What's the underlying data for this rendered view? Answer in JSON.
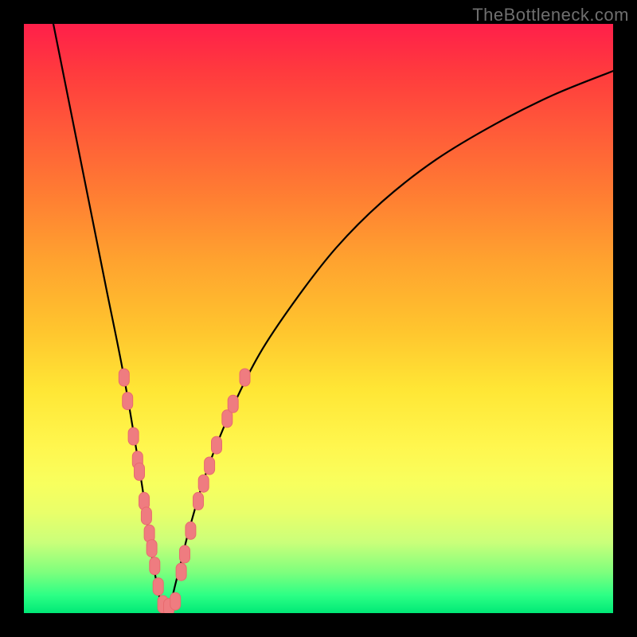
{
  "watermark": "TheBottleneck.com",
  "colors": {
    "frame": "#000000",
    "curve": "#000000",
    "marker_fill": "#ef7c80",
    "marker_stroke": "#e86a6e"
  },
  "chart_data": {
    "type": "line",
    "title": "",
    "xlabel": "",
    "ylabel": "",
    "xlim": [
      0,
      100
    ],
    "ylim": [
      0,
      100
    ],
    "note": "Unlabeled bottleneck curve: y is percentage mismatch vs. an optimum at x≈24. Values estimated from pixel positions on a 0–100 scale.",
    "series": [
      {
        "name": "bottleneck-curve",
        "x": [
          5,
          8,
          11,
          14,
          17,
          20,
          22,
          24,
          26,
          28,
          31,
          35,
          40,
          46,
          53,
          61,
          70,
          80,
          90,
          100
        ],
        "y": [
          100,
          85,
          70,
          55,
          40,
          22,
          8,
          0,
          6,
          14,
          24,
          34,
          44,
          53,
          62,
          70,
          77,
          83,
          88,
          92
        ]
      }
    ],
    "markers": {
      "name": "highlighted-points",
      "note": "Pink pill-shaped data markers clustered near the valley of the curve.",
      "points": [
        {
          "x": 17.0,
          "y": 40.0
        },
        {
          "x": 17.6,
          "y": 36.0
        },
        {
          "x": 18.6,
          "y": 30.0
        },
        {
          "x": 19.3,
          "y": 26.0
        },
        {
          "x": 19.6,
          "y": 24.0
        },
        {
          "x": 20.4,
          "y": 19.0
        },
        {
          "x": 20.8,
          "y": 16.5
        },
        {
          "x": 21.3,
          "y": 13.5
        },
        {
          "x": 21.7,
          "y": 11.0
        },
        {
          "x": 22.2,
          "y": 8.0
        },
        {
          "x": 22.8,
          "y": 4.5
        },
        {
          "x": 23.6,
          "y": 1.5
        },
        {
          "x": 24.6,
          "y": 1.0
        },
        {
          "x": 25.7,
          "y": 2.0
        },
        {
          "x": 26.7,
          "y": 7.0
        },
        {
          "x": 27.3,
          "y": 10.0
        },
        {
          "x": 28.3,
          "y": 14.0
        },
        {
          "x": 29.6,
          "y": 19.0
        },
        {
          "x": 30.5,
          "y": 22.0
        },
        {
          "x": 31.5,
          "y": 25.0
        },
        {
          "x": 32.7,
          "y": 28.5
        },
        {
          "x": 34.5,
          "y": 33.0
        },
        {
          "x": 35.5,
          "y": 35.5
        },
        {
          "x": 37.5,
          "y": 40.0
        }
      ]
    }
  }
}
